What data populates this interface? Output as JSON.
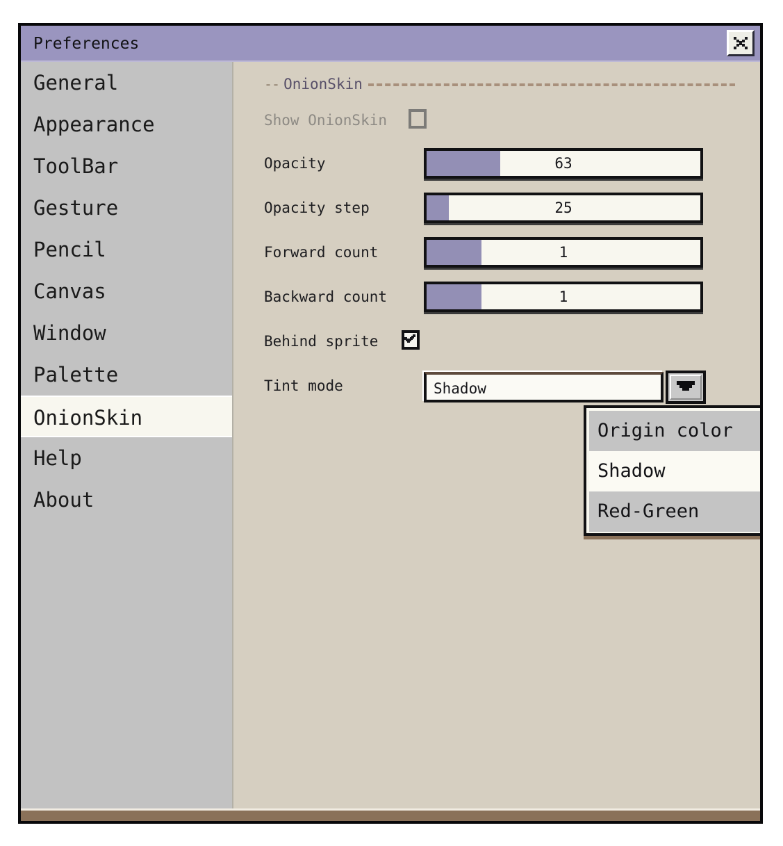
{
  "window": {
    "title": "Preferences",
    "close_icon": "close-x-icon"
  },
  "sidebar": {
    "items": [
      {
        "label": "General",
        "selected": false
      },
      {
        "label": "Appearance",
        "selected": false
      },
      {
        "label": "ToolBar",
        "selected": false
      },
      {
        "label": "Gesture",
        "selected": false
      },
      {
        "label": "Pencil",
        "selected": false
      },
      {
        "label": "Canvas",
        "selected": false
      },
      {
        "label": "Window",
        "selected": false
      },
      {
        "label": "Palette",
        "selected": false
      },
      {
        "label": "OnionSkin",
        "selected": true
      },
      {
        "label": "Help",
        "selected": false
      },
      {
        "label": "About",
        "selected": false
      }
    ]
  },
  "panel": {
    "group_title": "OnionSkin",
    "group_dash_prefix": "--",
    "show_onionskin": {
      "label": "Show OnionSkin",
      "checked": false,
      "disabled": true
    },
    "sliders": [
      {
        "label": "Opacity",
        "value": "63",
        "fill_percent": 27
      },
      {
        "label": "Opacity step",
        "value": "25",
        "fill_percent": 8
      },
      {
        "label": "Forward count",
        "value": "1",
        "fill_percent": 20
      },
      {
        "label": "Backward count",
        "value": "1",
        "fill_percent": 20
      }
    ],
    "behind_sprite": {
      "label": "Behind sprite",
      "checked": true
    },
    "tint_mode": {
      "label": "Tint mode",
      "value": "Shadow",
      "arrow_icon": "chevron-down-icon",
      "options": [
        {
          "label": "Origin color",
          "selected": false
        },
        {
          "label": "Shadow",
          "selected": true
        },
        {
          "label": "Red-Green",
          "selected": false
        }
      ]
    }
  },
  "colors": {
    "titlebar": "#9a95bf",
    "accent_purple": "#938fb5",
    "panel_bg": "#d6cfc1",
    "sidebar_bg": "#c2c2c2",
    "selected_item_bg": "#f8f7ef",
    "window_border": "#08080a",
    "bottom_shadow": "#8a7159"
  }
}
